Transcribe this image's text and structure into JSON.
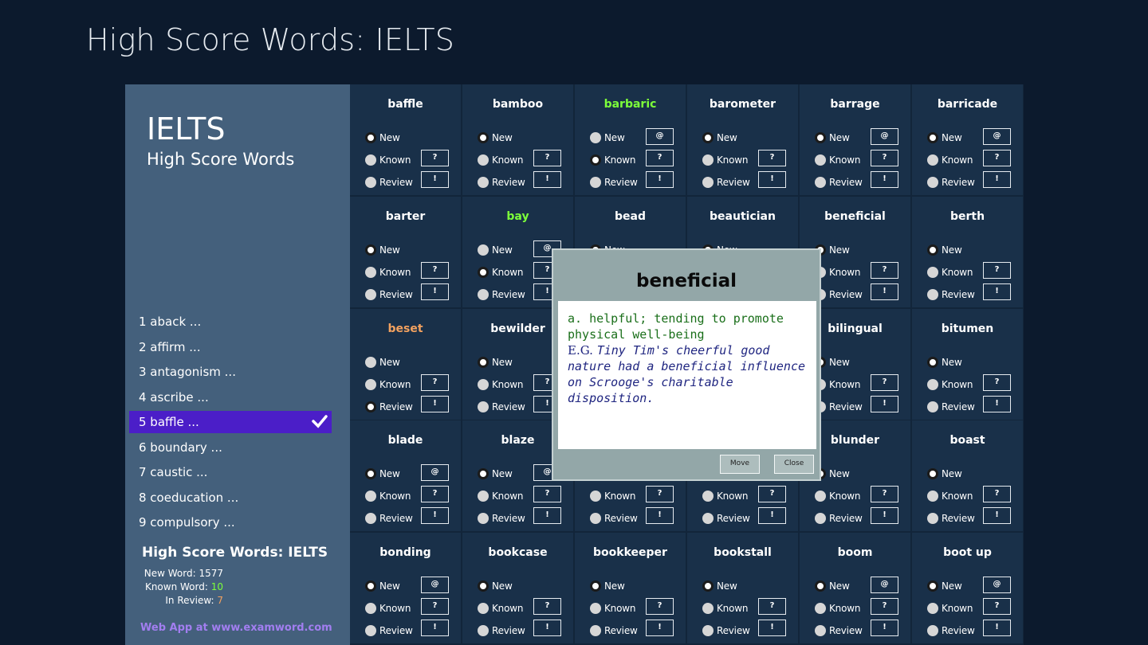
{
  "app_title": "High Score Words: IELTS",
  "sidebar": {
    "heading": "IELTS",
    "subheading": "High Score Words",
    "items": [
      {
        "label": "1 aback ..."
      },
      {
        "label": "2 affirm ..."
      },
      {
        "label": "3 antagonism ..."
      },
      {
        "label": "4 ascribe ..."
      },
      {
        "label": "5 baffle ...",
        "active": true
      },
      {
        "label": "6 boundary ..."
      },
      {
        "label": "7 caustic ..."
      },
      {
        "label": "8 coeducation ..."
      },
      {
        "label": "9 compulsory ..."
      }
    ],
    "stats_title": "High Score Words: IELTS",
    "new_label": "New Word: ",
    "new_value": "1577",
    "known_label": "Known Word: ",
    "known_value": "10",
    "review_label": "In Review: ",
    "review_value": "7",
    "web_link": "Web App at www.examword.com"
  },
  "options": {
    "new": "New",
    "known": "Known",
    "review": "Review"
  },
  "tags": {
    "at": "@",
    "q": "?",
    "ex": "!"
  },
  "colors": {
    "known": "#7cff3a",
    "review": "#f2a15f",
    "active": "#4b1ec8"
  },
  "words": [
    {
      "word": "baffle",
      "state": "new",
      "at": false
    },
    {
      "word": "bamboo",
      "state": "new",
      "at": false
    },
    {
      "word": "barbaric",
      "state": "known",
      "at": true
    },
    {
      "word": "barometer",
      "state": "new",
      "at": false
    },
    {
      "word": "barrage",
      "state": "new",
      "at": true
    },
    {
      "word": "barricade",
      "state": "new",
      "at": true
    },
    {
      "word": "barter",
      "state": "new",
      "at": false
    },
    {
      "word": "bay",
      "state": "known",
      "at": true
    },
    {
      "word": "bead",
      "state": "new",
      "at": false
    },
    {
      "word": "beautician",
      "state": "new",
      "at": false
    },
    {
      "word": "beneficial",
      "state": "new",
      "at": false
    },
    {
      "word": "berth",
      "state": "new",
      "at": false
    },
    {
      "word": "beset",
      "state": "review",
      "at": false
    },
    {
      "word": "bewilder",
      "state": "new",
      "at": false
    },
    {
      "word": "",
      "state": "new",
      "at": false
    },
    {
      "word": "",
      "state": "new",
      "at": false
    },
    {
      "word": "bilingual",
      "state": "new",
      "at": false
    },
    {
      "word": "bitumen",
      "state": "new",
      "at": false
    },
    {
      "word": "blade",
      "state": "new",
      "at": true
    },
    {
      "word": "blaze",
      "state": "new",
      "at": true
    },
    {
      "word": "",
      "state": "new",
      "at": false
    },
    {
      "word": "",
      "state": "new",
      "at": false
    },
    {
      "word": "blunder",
      "state": "new",
      "at": false
    },
    {
      "word": "boast",
      "state": "new",
      "at": false
    },
    {
      "word": "bonding",
      "state": "new",
      "at": true
    },
    {
      "word": "bookcase",
      "state": "new",
      "at": false
    },
    {
      "word": "bookkeeper",
      "state": "new",
      "at": false
    },
    {
      "word": "bookstall",
      "state": "new",
      "at": false
    },
    {
      "word": "boom",
      "state": "new",
      "at": true
    },
    {
      "word": "boot up",
      "state": "new",
      "at": true
    }
  ],
  "dialog": {
    "title": "beneficial",
    "definition": "a. helpful; tending to promote physical well-being",
    "eg_label": "E.G. ",
    "example": "Tiny Tim's cheerful good nature had a beneficial influence on Scrooge's charitable disposition.",
    "move_label": "Move",
    "close_label": "Close"
  }
}
